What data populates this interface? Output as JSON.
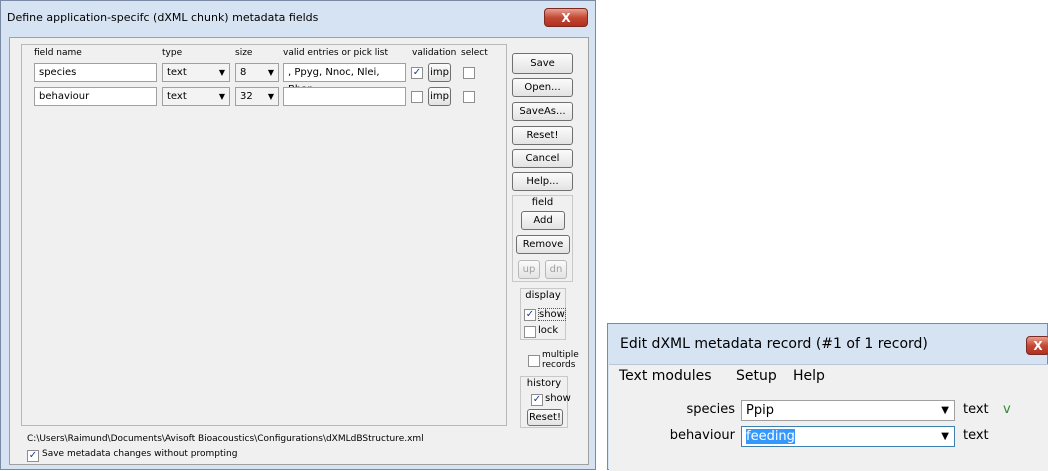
{
  "dialog1": {
    "title": "Define application-specifc (dXML chunk) metadata fields",
    "close_label": "X",
    "headers": {
      "field_name": "field name",
      "type": "type",
      "size": "size",
      "valid": "valid entries or pick list",
      "validation": "validation",
      "select": "select"
    },
    "rows": [
      {
        "field_name": "species",
        "type": "text",
        "size": "8",
        "valid": ", Ppyg, Nnoc, Nlei, Bbar",
        "validation_checked": true,
        "imp": "imp",
        "select_checked": false
      },
      {
        "field_name": "behaviour",
        "type": "text",
        "size": "32",
        "valid": "",
        "validation_checked": false,
        "imp": "imp",
        "select_checked": false
      }
    ],
    "buttons": {
      "save": "Save",
      "open": "Open...",
      "saveas": "SaveAs...",
      "reset": "Reset!",
      "cancel": "Cancel",
      "help": "Help..."
    },
    "field_group": {
      "label": "field",
      "add": "Add",
      "remove": "Remove",
      "up": "up",
      "dn": "dn"
    },
    "display_group": {
      "label": "display",
      "show": "show",
      "show_checked": true,
      "lock": "lock",
      "lock_checked": false
    },
    "multiple_records": {
      "label_line1": "multiple",
      "label_line2": "records",
      "checked": false
    },
    "history_group": {
      "label": "history",
      "show": "show",
      "show_checked": true,
      "reset": "Reset!"
    },
    "path": "C:\\Users\\Raimund\\Documents\\Avisoft Bioacoustics\\Configurations\\dXMLdBStructure.xml",
    "save_without_prompting": {
      "label": "Save metadata changes without prompting",
      "checked": true
    }
  },
  "dialog2": {
    "title": "Edit dXML metadata record (#1 of 1 record)",
    "close_label": "X",
    "menu": [
      "Text modules",
      "Setup",
      "Help"
    ],
    "rows": [
      {
        "label": "species",
        "value": "Ppip",
        "type": "text",
        "check": "v"
      },
      {
        "label": "behaviour",
        "value": "feeding",
        "type": "text",
        "check": ""
      }
    ]
  }
}
